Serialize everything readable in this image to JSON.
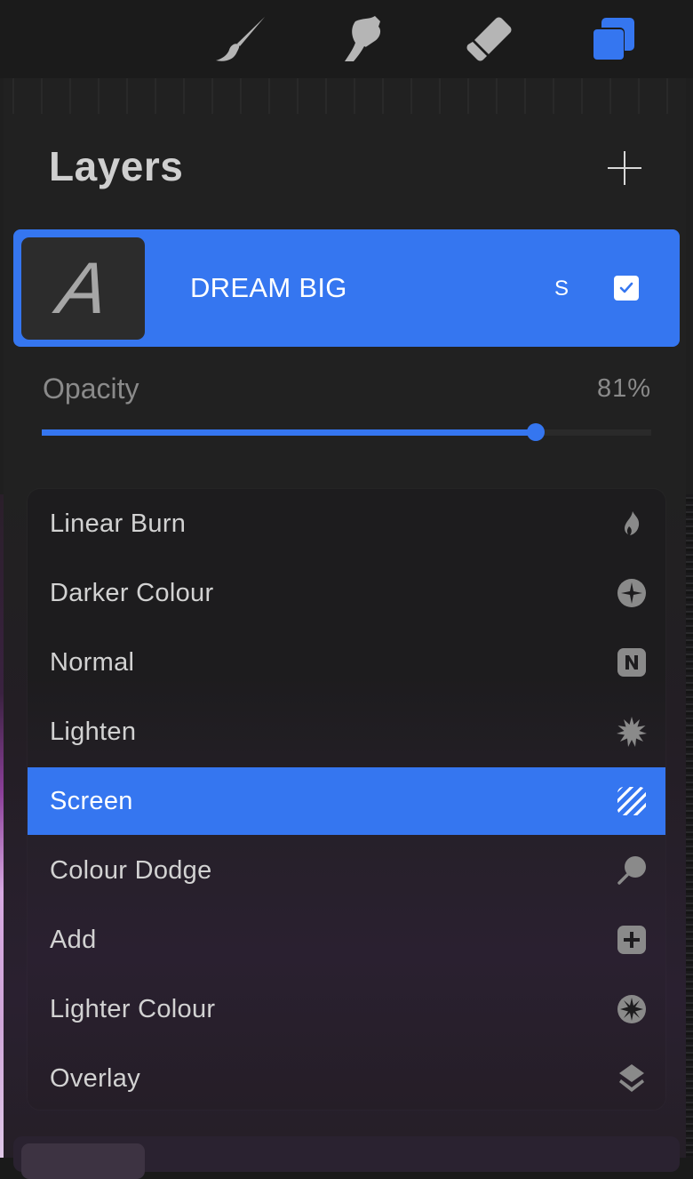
{
  "toolbar": {
    "tools": [
      {
        "name": "brush",
        "icon": "brush-icon",
        "active": false
      },
      {
        "name": "smudge",
        "icon": "smudge-icon",
        "active": false
      },
      {
        "name": "eraser",
        "icon": "eraser-icon",
        "active": false
      },
      {
        "name": "layers",
        "icon": "layers-icon",
        "active": true
      }
    ]
  },
  "colors": {
    "accent": "#3576f0",
    "panel_bg": "#212121",
    "icon_gray": "#b5b5b5"
  },
  "panel": {
    "title": "Layers",
    "add_icon": "plus-icon"
  },
  "layer": {
    "thumbnail_glyph": "A",
    "name": "DREAM BIG",
    "blend_mode_abbrev": "S",
    "visible": true
  },
  "opacity": {
    "label": "Opacity",
    "value_text": "81%",
    "value": 0.81
  },
  "blend_modes": {
    "selected": "Screen",
    "items": [
      {
        "label": "Linear Burn",
        "icon": "flame-icon"
      },
      {
        "label": "Darker Colour",
        "icon": "sparkle-circle-icon"
      },
      {
        "label": "Normal",
        "icon": "n-badge-icon"
      },
      {
        "label": "Lighten",
        "icon": "starburst-icon"
      },
      {
        "label": "Screen",
        "icon": "striped-square-icon"
      },
      {
        "label": "Colour Dodge",
        "icon": "magnifier-icon"
      },
      {
        "label": "Add",
        "icon": "plus-square-icon"
      },
      {
        "label": "Lighter Colour",
        "icon": "star-circle-icon"
      },
      {
        "label": "Overlay",
        "icon": "stack-icon"
      }
    ]
  }
}
